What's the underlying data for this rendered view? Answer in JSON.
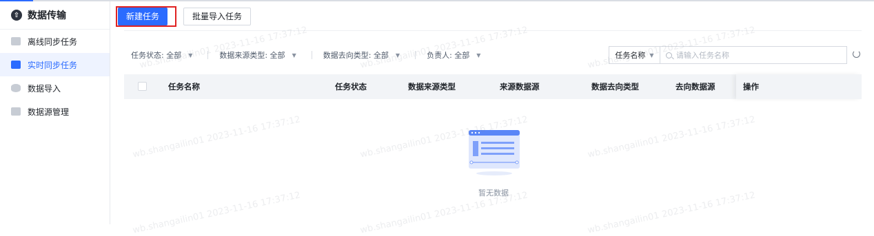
{
  "sidebar": {
    "title": "数据传输",
    "items": [
      {
        "label": "离线同步任务",
        "active": false,
        "icon": "chart-icon"
      },
      {
        "label": "实时同步任务",
        "active": true,
        "icon": "calendar-icon"
      },
      {
        "label": "数据导入",
        "active": false,
        "icon": "database-icon"
      },
      {
        "label": "数据源管理",
        "active": false,
        "icon": "list-icon"
      }
    ]
  },
  "toolbar": {
    "new_task": "新建任务",
    "batch_import": "批量导入任务"
  },
  "filters": {
    "status": "任务状态: 全部",
    "source_type": "数据来源类型: 全部",
    "target_type": "数据去向类型: 全部",
    "owner": "负责人: 全部"
  },
  "search": {
    "field": "任务名称",
    "placeholder": "请输入任务名称"
  },
  "table": {
    "columns": [
      "任务名称",
      "任务状态",
      "数据来源类型",
      "来源数据源",
      "数据去向类型",
      "去向数据源",
      "操作"
    ]
  },
  "empty": {
    "text": "暂无数据"
  },
  "watermark": "wb.shangailin01 2023-11-16 17:37:12",
  "colors": {
    "primary": "#2b6bff",
    "highlight_box": "#e02020"
  }
}
